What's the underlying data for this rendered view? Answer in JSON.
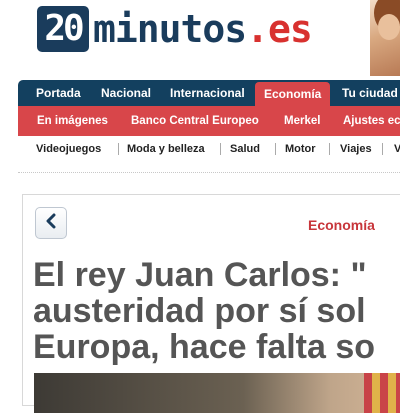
{
  "logo": {
    "number": "20",
    "word": "minutos",
    "tld": ".es"
  },
  "nav": {
    "items": [
      {
        "label": "Portada",
        "active": false
      },
      {
        "label": "Nacional",
        "active": false
      },
      {
        "label": "Internacional",
        "active": false
      },
      {
        "label": "Economía",
        "active": true
      },
      {
        "label": "Tu ciudad",
        "active": false
      }
    ]
  },
  "subnav": {
    "items": [
      {
        "label": "En imágenes"
      },
      {
        "label": "Banco Central Europeo"
      },
      {
        "label": "Merkel"
      },
      {
        "label": "Ajustes ec"
      }
    ]
  },
  "topics": {
    "items": [
      {
        "label": "Videojuegos"
      },
      {
        "label": "Moda y belleza"
      },
      {
        "label": "Salud"
      },
      {
        "label": "Motor"
      },
      {
        "label": "Viajes"
      },
      {
        "label": "V"
      }
    ]
  },
  "article": {
    "back_icon": "chevron-left-icon",
    "section": "Economía",
    "headline_lines": [
      "El rey Juan Carlos: \"",
      "austeridad por sí sol",
      "Europa, hace falta so"
    ]
  },
  "colors": {
    "brand_navy": "#1a3c5c",
    "brand_red": "#d8464a",
    "section_red": "#c8363b",
    "headline_gray": "#555555"
  }
}
